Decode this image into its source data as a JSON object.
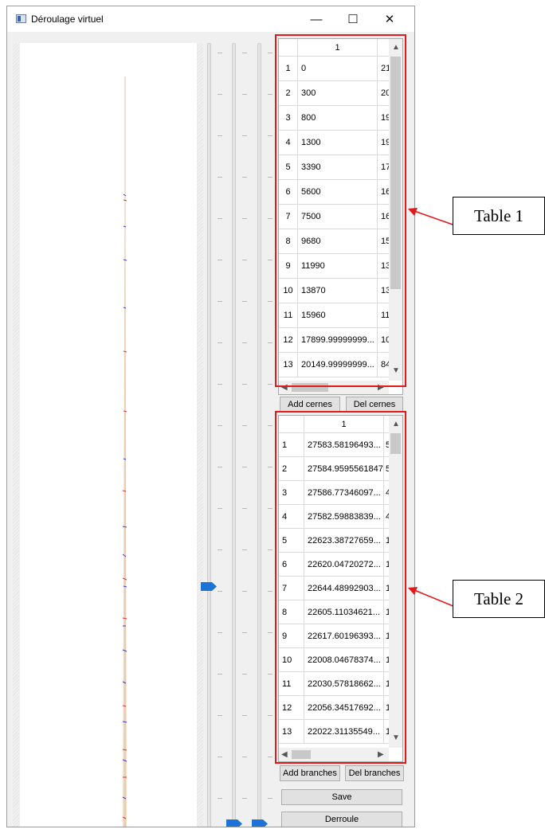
{
  "window": {
    "title": "Déroulage virtuel",
    "minimize_glyph": "—",
    "maximize_glyph": "☐",
    "close_glyph": "✕"
  },
  "table1": {
    "column_header": "1",
    "rows": [
      {
        "n": "1",
        "v": "0",
        "c2": "21"
      },
      {
        "n": "2",
        "v": "300",
        "c2": "20"
      },
      {
        "n": "3",
        "v": "800",
        "c2": "19"
      },
      {
        "n": "4",
        "v": "1300",
        "c2": "19"
      },
      {
        "n": "5",
        "v": "3390",
        "c2": "17"
      },
      {
        "n": "6",
        "v": "5600",
        "c2": "16"
      },
      {
        "n": "7",
        "v": "7500",
        "c2": "16"
      },
      {
        "n": "8",
        "v": "9680",
        "c2": "15"
      },
      {
        "n": "9",
        "v": "11990",
        "c2": "13"
      },
      {
        "n": "10",
        "v": "13870",
        "c2": "13"
      },
      {
        "n": "11",
        "v": "15960",
        "c2": "11"
      },
      {
        "n": "12",
        "v": "17899.99999999...",
        "c2": "10"
      },
      {
        "n": "13",
        "v": "20149.99999999...",
        "c2": "84"
      }
    ]
  },
  "table2": {
    "column_header": "1",
    "rows": [
      {
        "n": "1",
        "v": "27583.58196493...",
        "c2": "5"
      },
      {
        "n": "2",
        "v": "27584.9595561847",
        "c2": "5"
      },
      {
        "n": "3",
        "v": "27586.77346097...",
        "c2": "4"
      },
      {
        "n": "4",
        "v": "27582.59883839...",
        "c2": "4"
      },
      {
        "n": "5",
        "v": "22623.38727659...",
        "c2": "1"
      },
      {
        "n": "6",
        "v": "22620.04720272...",
        "c2": "1"
      },
      {
        "n": "7",
        "v": "22644.48992903...",
        "c2": "1"
      },
      {
        "n": "8",
        "v": "22605.11034621...",
        "c2": "1"
      },
      {
        "n": "9",
        "v": "22617.60196393...",
        "c2": "1"
      },
      {
        "n": "10",
        "v": "22008.04678374...",
        "c2": "1"
      },
      {
        "n": "11",
        "v": "22030.57818662...",
        "c2": "1"
      },
      {
        "n": "12",
        "v": "22056.34517692...",
        "c2": "1"
      },
      {
        "n": "13",
        "v": "22022.31135549...",
        "c2": "1"
      }
    ]
  },
  "buttons": {
    "add_cernes": "Add cernes",
    "del_cernes": "Del cernes",
    "add_branches": "Add branches",
    "del_branches": "Del branches",
    "save": "Save",
    "derroule": "Derroule"
  },
  "annotations": {
    "table1": "Table 1",
    "table2": "Table 2",
    "highlight_color": "#e31a1c"
  },
  "icons": {
    "scroll_up": "▲",
    "scroll_down": "▼",
    "scroll_left": "◀",
    "scroll_right": "▶"
  }
}
